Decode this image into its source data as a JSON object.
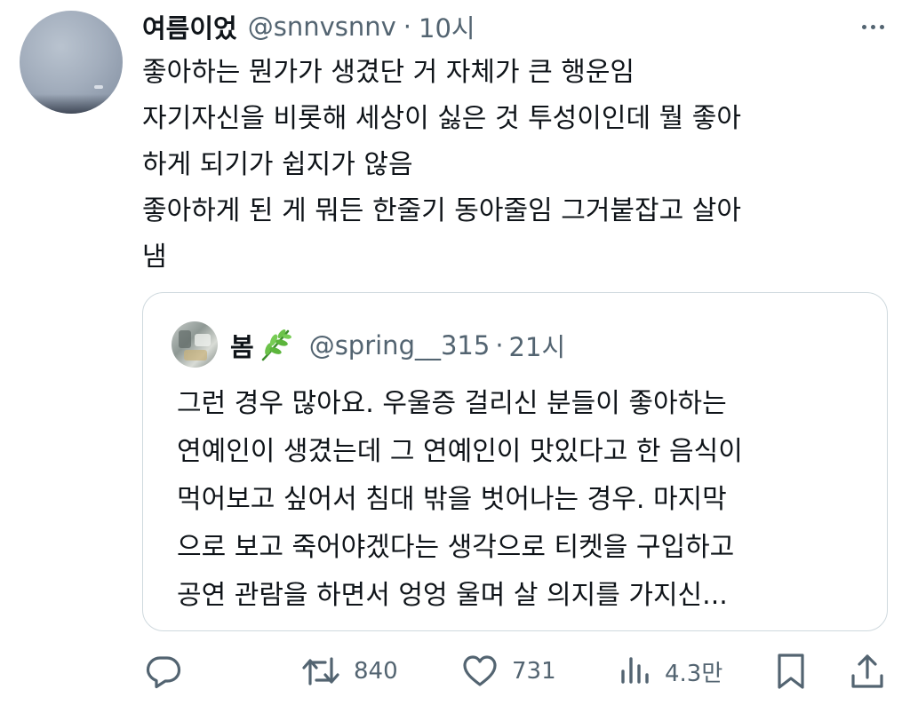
{
  "tweet": {
    "display_name": "여름이었",
    "handle": "@snnvsnnv",
    "separator": "·",
    "time": "10시",
    "text_lines": [
      "좋아하는 뭔가가 생겼단 거 자체가 큰 행운임",
      "자기자신을 비롯해 세상이 싫은 것 투성이인데 뭘 좋아",
      "하게 되기가 쉽지가 않음",
      "좋아하게 된 게 뭐든 한줄기 동아줄임 그거붙잡고 살아",
      "냄"
    ]
  },
  "quote": {
    "display_name": "봄",
    "name_emoji": "herb-icon",
    "handle": "@spring__315",
    "separator": "·",
    "time": "21시",
    "text_lines": [
      "그런 경우 많아요. 우울증 걸리신 분들이 좋아하는",
      "연예인이 생겼는데 그 연예인이 맛있다고 한 음식이",
      "먹어보고 싶어서 침대 밖을 벗어나는 경우. 마지막",
      "으로 보고 죽어야겠다는 생각으로 티켓을 구입하고",
      "공연 관람을 하면서 엉엉 울며 살 의지를 가지신..."
    ]
  },
  "actions": {
    "reply_icon": "reply-icon",
    "retweet_icon": "retweet-icon",
    "retweet_count": "840",
    "like_icon": "heart-icon",
    "like_count": "731",
    "views_icon": "views-icon",
    "views_count": "4.3만",
    "bookmark_icon": "bookmark-icon",
    "share_icon": "share-icon"
  },
  "colors": {
    "text_primary": "#0f1419",
    "text_secondary": "#536471",
    "border": "#cfd9de"
  }
}
